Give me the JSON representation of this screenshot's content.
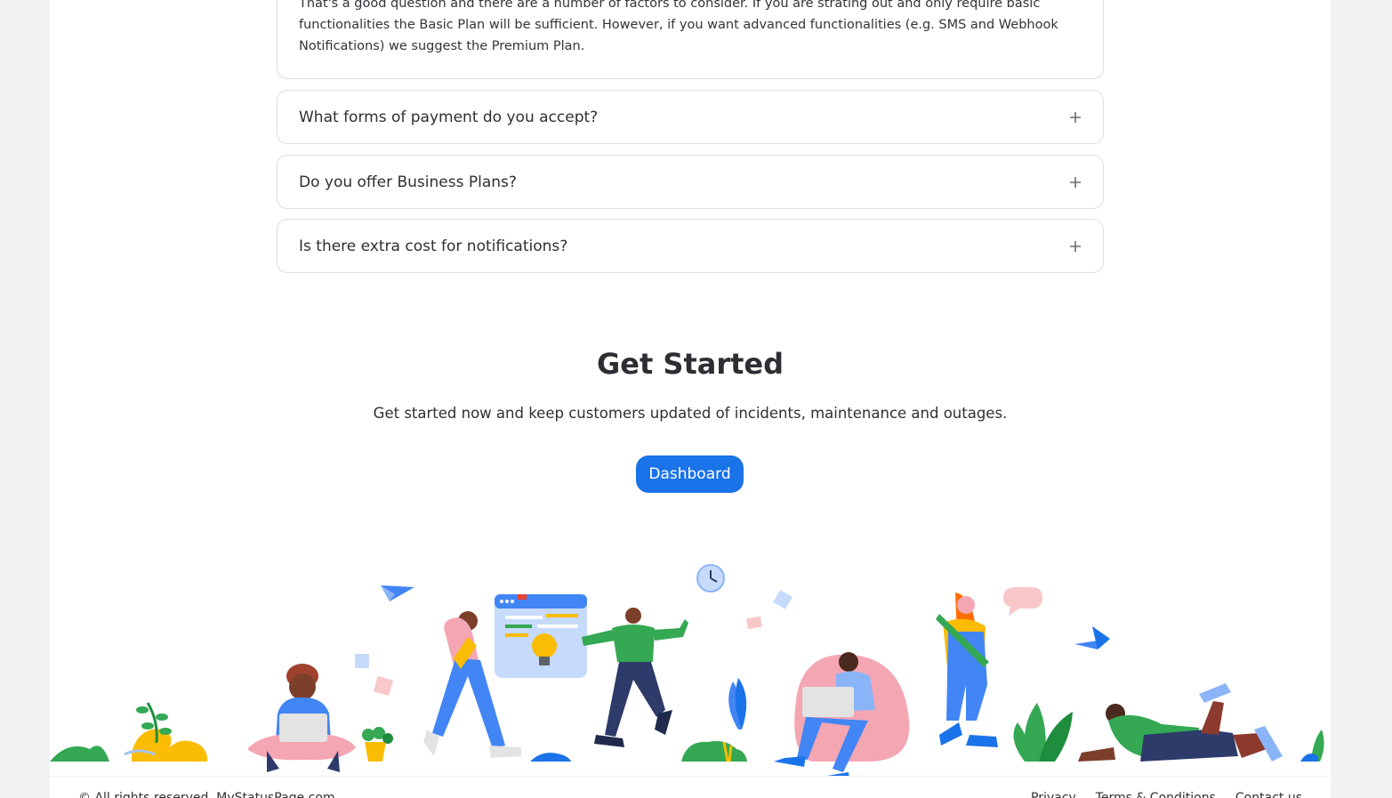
{
  "faq": {
    "open_answer": "That's a good question and there are a number of factors to consider. If you are strating out and only require basic functionalities the Basic Plan will be sufficient. However, if you want advanced functionalities (e.g. SMS and Webhook Notifications) we suggest the Premium Plan.",
    "items": [
      {
        "question": "What forms of payment do you accept?"
      },
      {
        "question": "Do you offer Business Plans?"
      },
      {
        "question": "Is there extra cost for notifications?"
      }
    ]
  },
  "get_started": {
    "title": "Get Started",
    "subtitle": "Get started now and keep customers updated of incidents, maintenance and outages.",
    "button_label": "Dashboard"
  },
  "footer": {
    "copyright": "© All rights reserved. MyStatusPage.com",
    "links": [
      "Privacy",
      "Terms & Conditions",
      "Contact us"
    ]
  },
  "icons": {
    "expand": "plus-icon"
  },
  "colors": {
    "accent": "#1a73e8",
    "page_bg": "#f1f2f4",
    "card_border": "#dcdde2"
  }
}
